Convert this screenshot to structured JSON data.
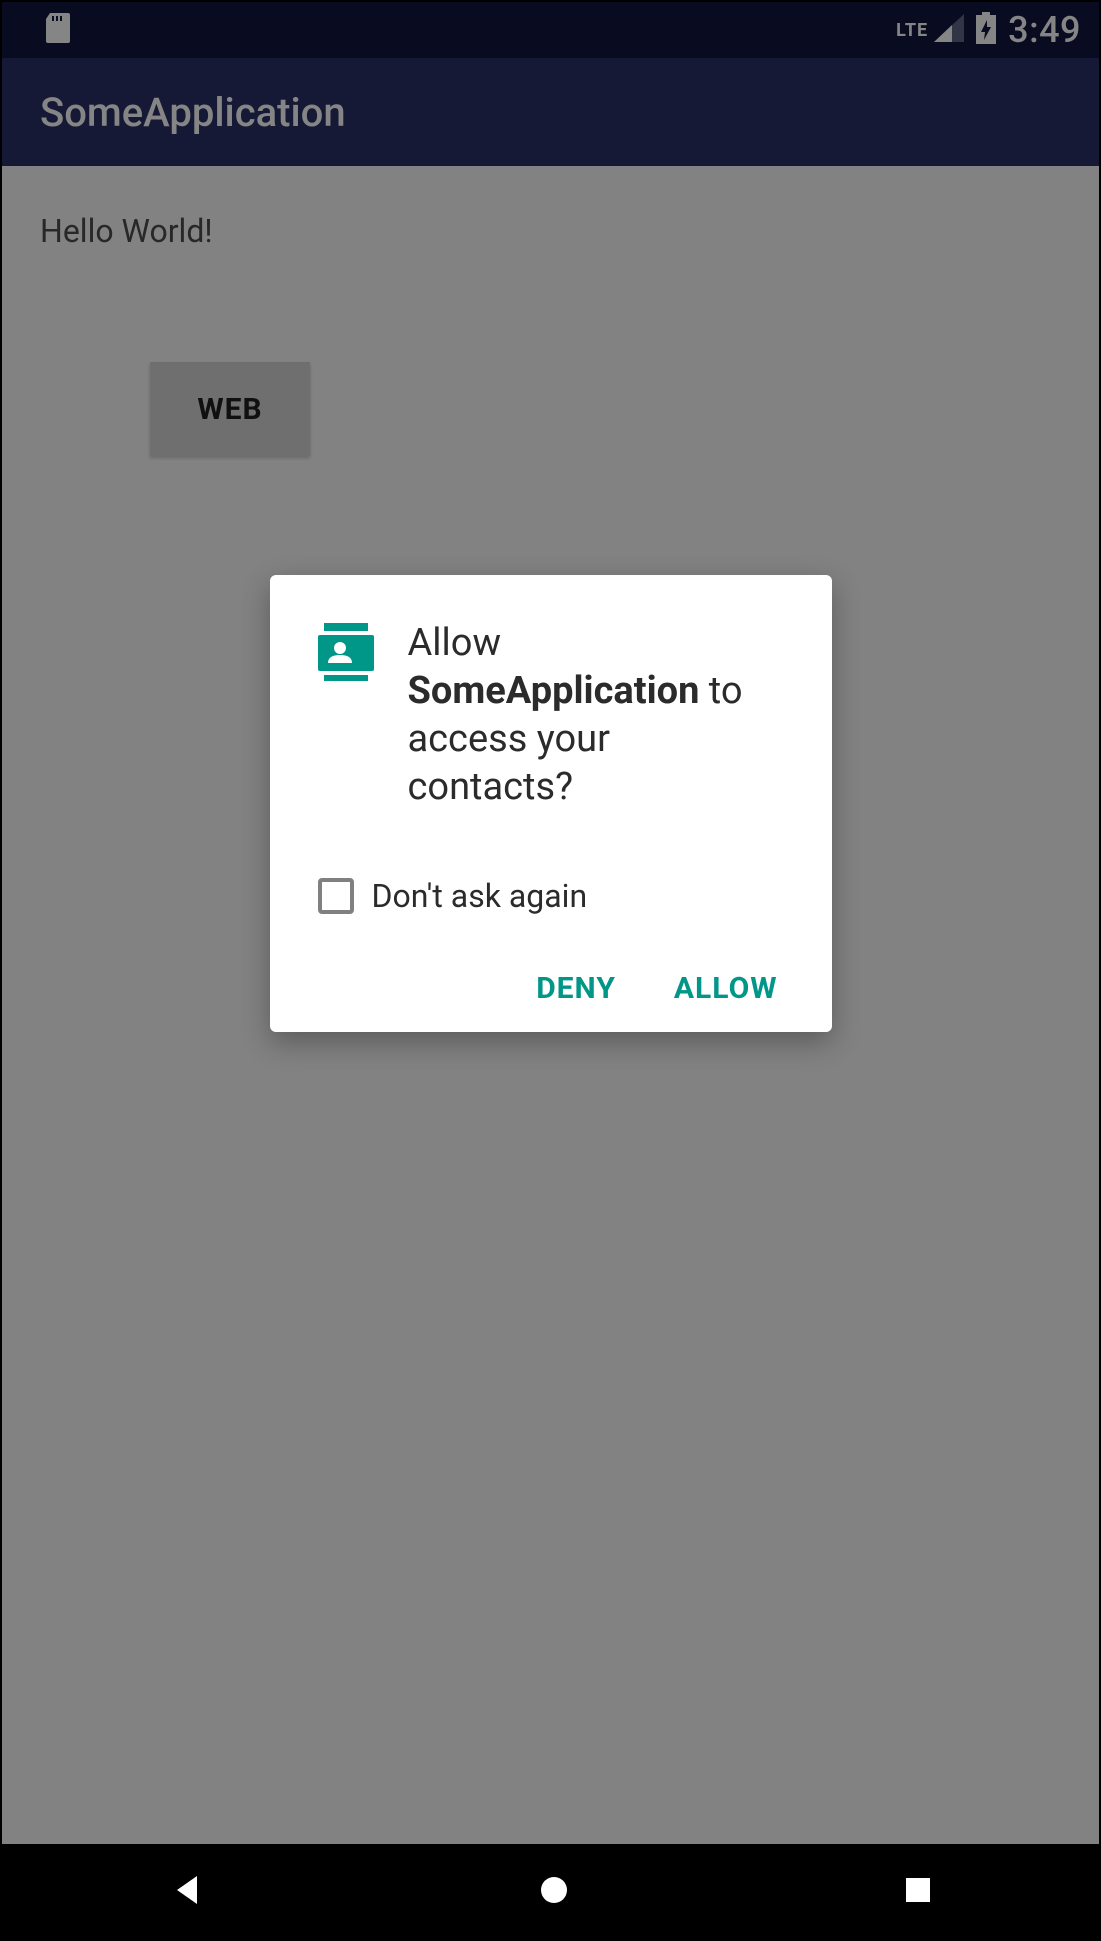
{
  "status": {
    "network": "LTE",
    "time": "3:49"
  },
  "app": {
    "title": "SomeApplication"
  },
  "content": {
    "hello": "Hello World!",
    "web_button": "WEB"
  },
  "dialog": {
    "prefix": "Allow ",
    "app_name": "SomeApplication",
    "suffix": " to access your contacts?",
    "dont_ask": "Don't ask again",
    "deny": "DENY",
    "allow": "ALLOW"
  },
  "colors": {
    "primary_dark": "#12183e",
    "primary": "#2a3066",
    "accent": "#009688"
  }
}
